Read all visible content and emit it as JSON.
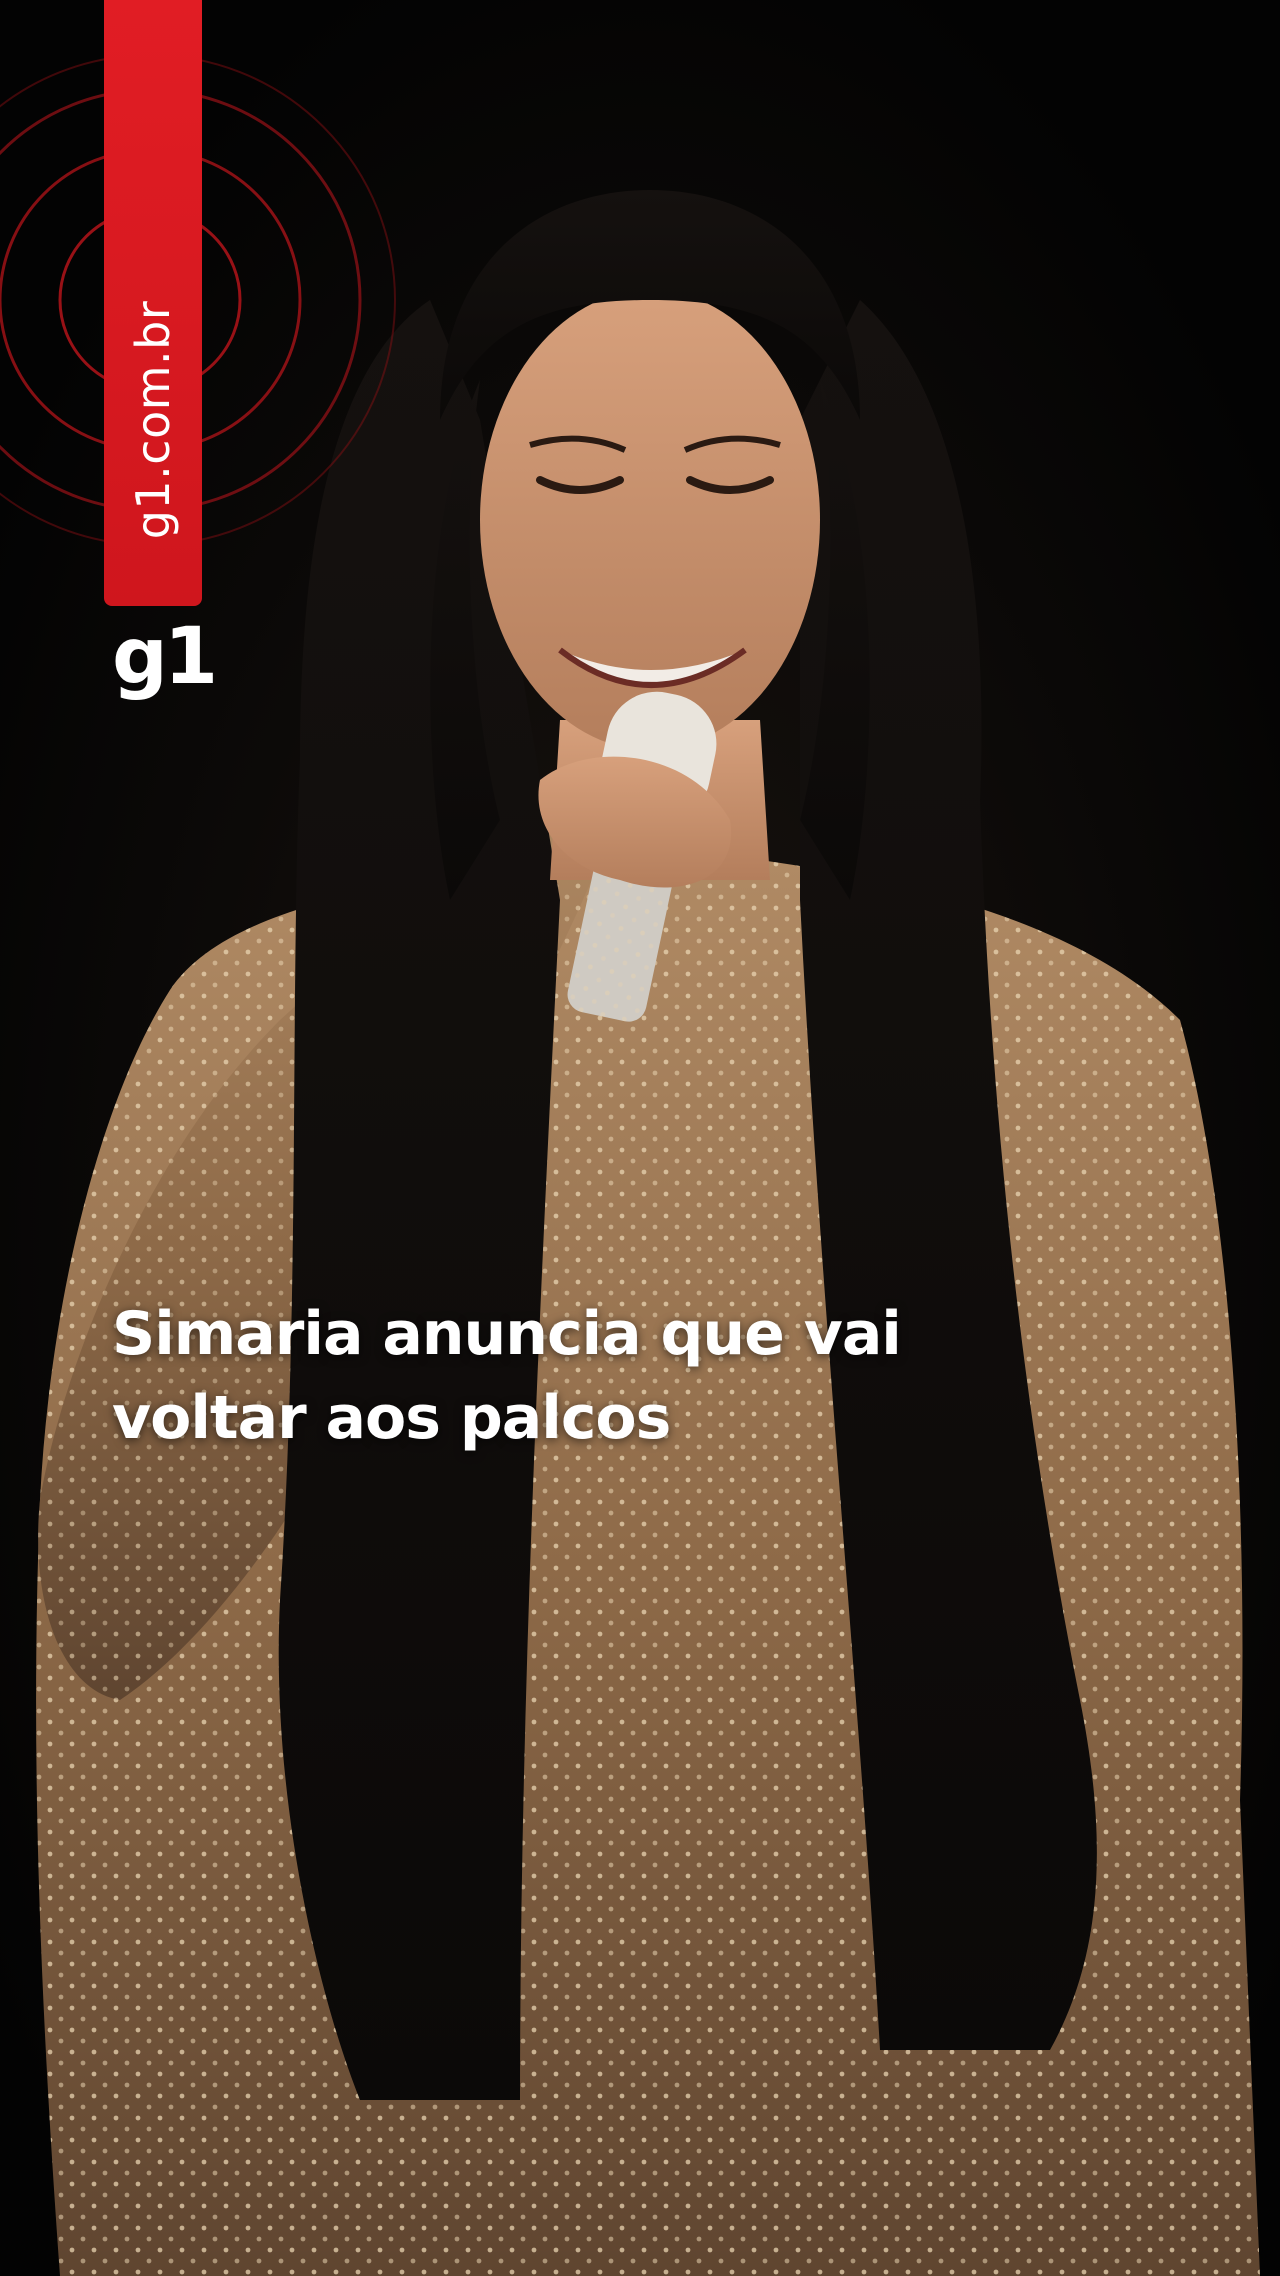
{
  "brand": {
    "url_text": "g1.com.br",
    "logo_text": "g1",
    "accent_color": "#e11d24"
  },
  "headline": {
    "line1": "Simaria anuncia que vai",
    "line2": "voltar aos palcos"
  },
  "photo": {
    "icon": "singer-on-stage-photo"
  }
}
